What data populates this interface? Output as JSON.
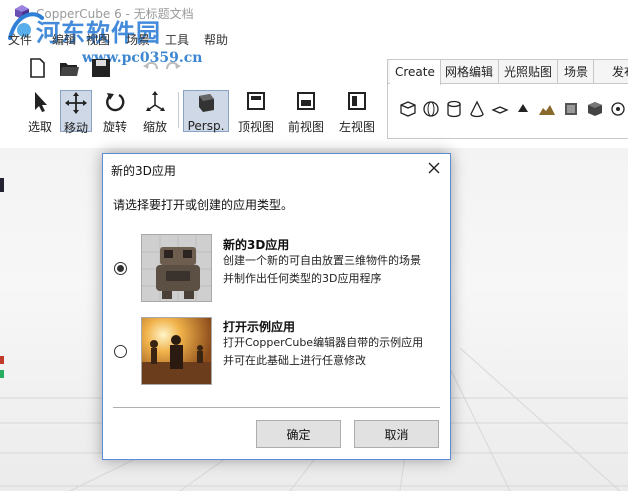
{
  "window": {
    "title": "CopperCube 6 - 无标题文档"
  },
  "watermark": {
    "site_name": "河东软件园",
    "url": "www.pc0359.cn"
  },
  "menu": {
    "items": [
      {
        "label": "文件"
      },
      {
        "label": "编辑"
      },
      {
        "label": "视图"
      },
      {
        "label": "场景"
      },
      {
        "label": "工具"
      },
      {
        "label": "帮助"
      }
    ]
  },
  "toolbar": {
    "tools": [
      {
        "label": "选取",
        "icon": "cursor-arrow-icon"
      },
      {
        "label": "移动",
        "icon": "move-arrows-icon"
      },
      {
        "label": "旋转",
        "icon": "rotate-icon"
      },
      {
        "label": "缩放",
        "icon": "scale-icon"
      },
      {
        "label": "Persp.",
        "icon": "perspective-cube-icon"
      },
      {
        "label": "顶视图",
        "icon": "top-view-icon"
      },
      {
        "label": "前视图",
        "icon": "front-view-icon"
      },
      {
        "label": "左视图",
        "icon": "left-view-icon"
      }
    ],
    "active_tools": [
      "移动",
      "Persp."
    ]
  },
  "create_panel": {
    "tabs": [
      "Create",
      "网格编辑",
      "光照贴图",
      "场景",
      "发布"
    ],
    "active_tab": "Create",
    "shapes": [
      "cube-icon",
      "sphere-icon",
      "cylinder-icon",
      "cone-icon",
      "plane-icon",
      "billboard-icon",
      "terrain-icon",
      "skybox-icon",
      "mesh-icon",
      "light-icon"
    ]
  },
  "dialog": {
    "title": "新的3D应用",
    "prompt": "请选择要打开或创建的应用类型。",
    "options": [
      {
        "title": "新的3D应用",
        "desc_line1": "创建一个新的可自由放置三维物件的场景",
        "desc_line2": "并制作出任何类型的3D应用程序",
        "selected": true
      },
      {
        "title": "打开示例应用",
        "desc_line1": "打开CopperCube编辑器自带的示例应用",
        "desc_line2": "并可在此基础上进行任意修改",
        "selected": false
      }
    ],
    "ok_label": "确定",
    "cancel_label": "取消"
  },
  "colors": {
    "dialog_border": "#5b8dd6",
    "watermark_blue": "#2f7fd6",
    "active_tool_bg": "#cfd8e6"
  }
}
